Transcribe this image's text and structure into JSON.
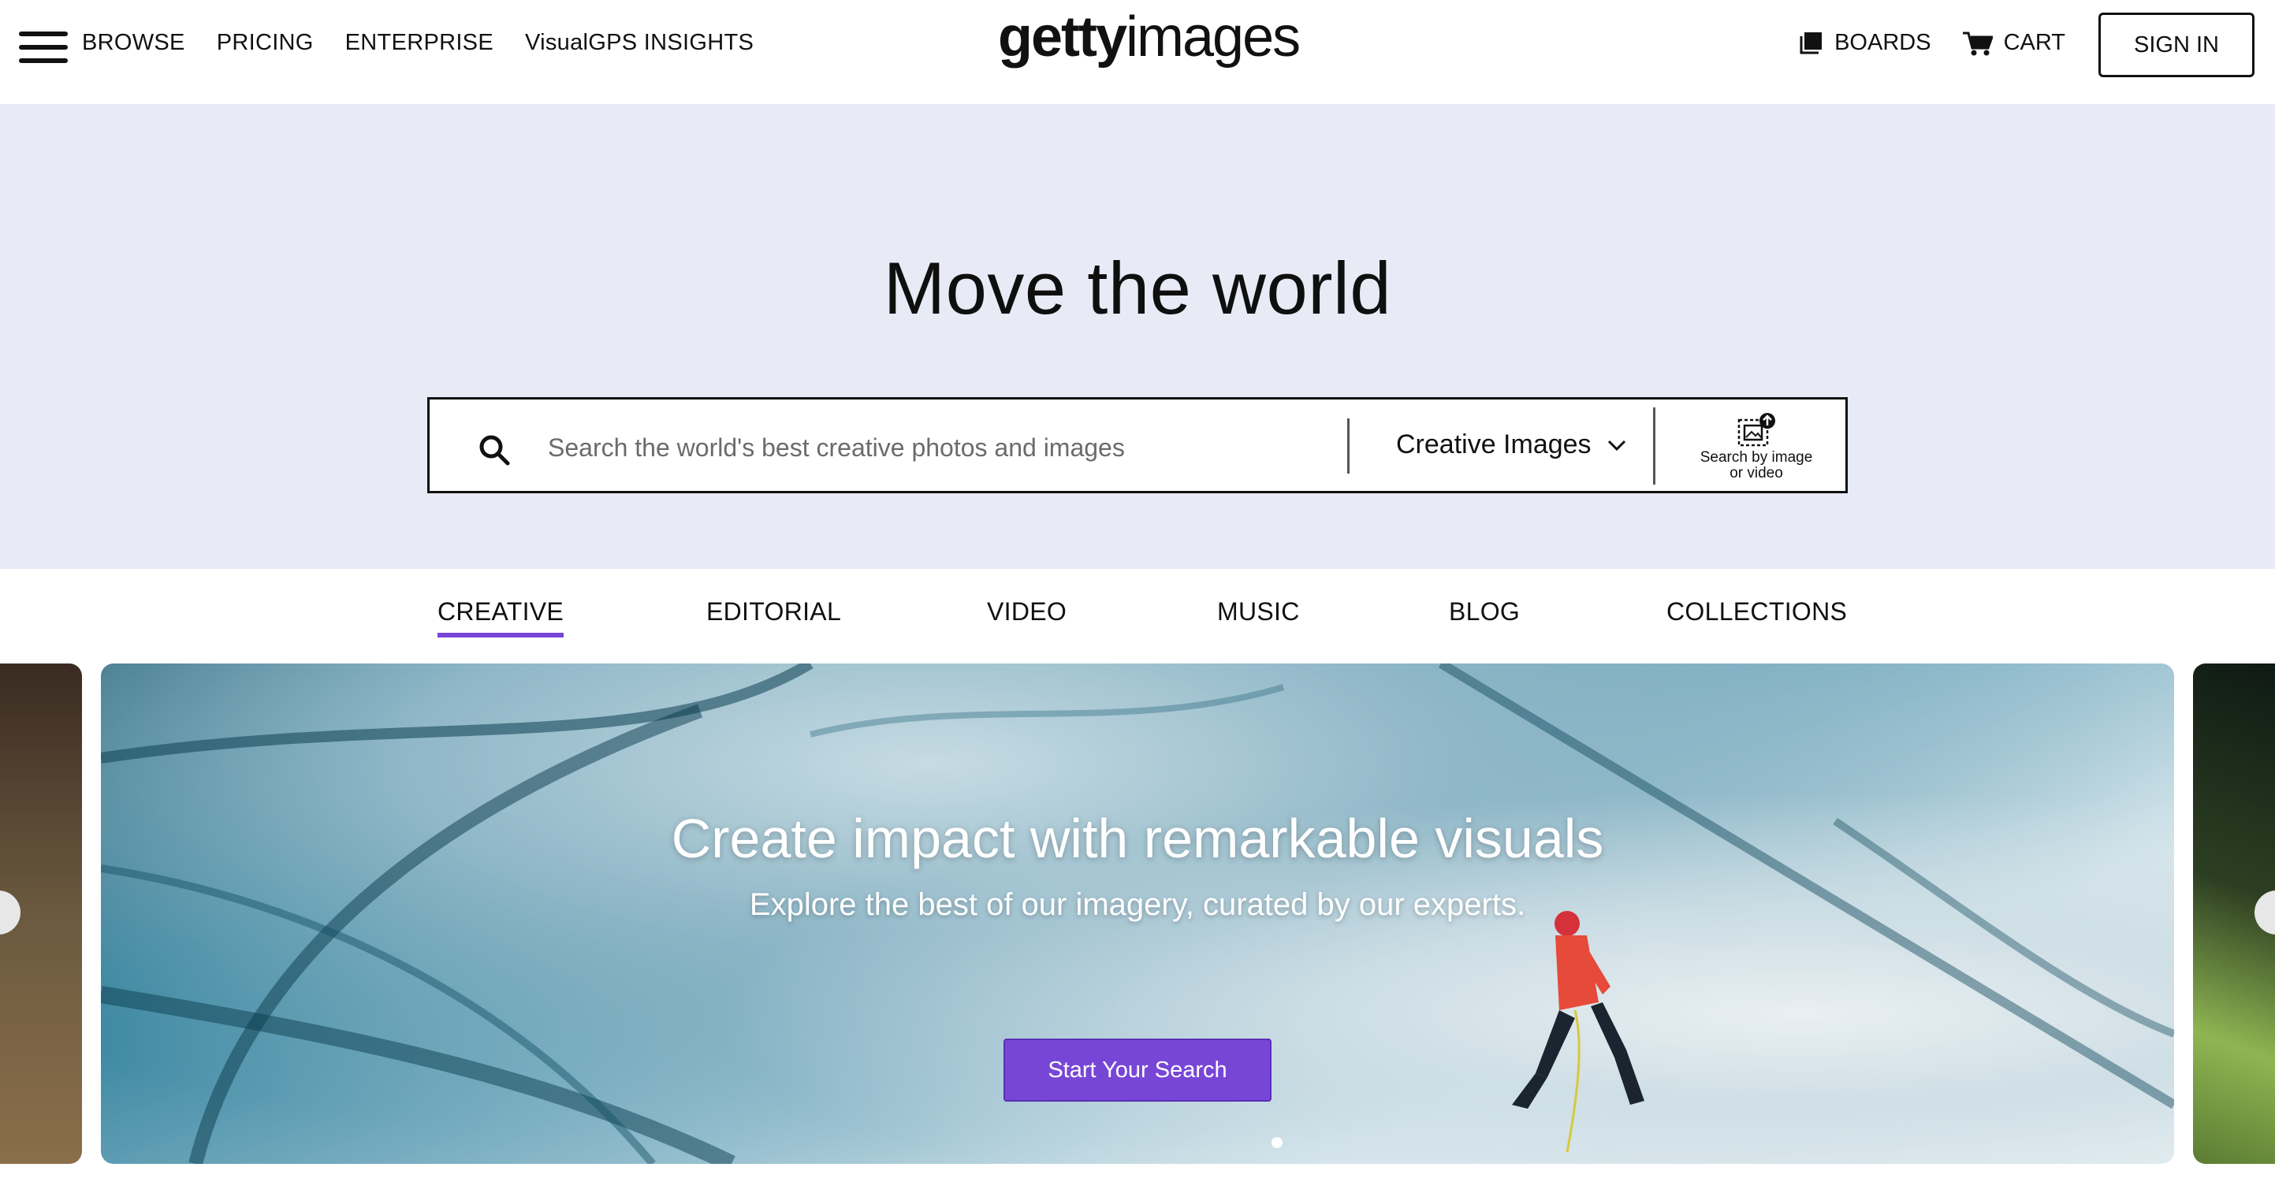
{
  "header": {
    "nav_left": [
      "BROWSE",
      "PRICING",
      "ENTERPRISE",
      "VisualGPS INSIGHTS"
    ],
    "logo_bold": "getty",
    "logo_light": "images",
    "boards_label": "BOARDS",
    "cart_label": "CART",
    "signin_label": "SIGN IN"
  },
  "hero": {
    "title": "Move the world",
    "search": {
      "placeholder": "Search the world's best creative photos and images",
      "type_selected": "Creative Images",
      "image_search_label_1": "Search by image",
      "image_search_label_2": "or video"
    }
  },
  "tabs": [
    "CREATIVE",
    "EDITORIAL",
    "VIDEO",
    "MUSIC",
    "BLOG",
    "COLLECTIONS"
  ],
  "carousel": {
    "title": "Create impact with remarkable visuals",
    "subtitle": "Explore the best of our imagery, curated by our experts.",
    "cta_label": "Start Your Search"
  },
  "colors": {
    "accent": "#7846d6",
    "hero_bg": "#e8eaf6"
  }
}
